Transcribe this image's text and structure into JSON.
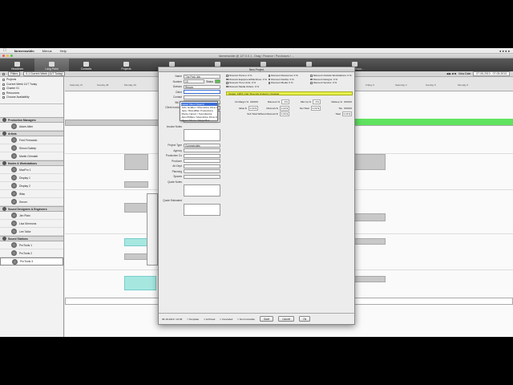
{
  "menubar": {
    "app": "farmerswidin",
    "items": [
      "Menus",
      "Help"
    ]
  },
  "window": {
    "title": "farmerswidin @ 127.0.0.1 - Drag / Finance / Purchases / ..."
  },
  "toolbar": {
    "items": [
      "Headlines",
      "Lang Paint",
      "Contacts",
      "Projects",
      "Invoice Project",
      "Event Schedule",
      "Direct Reports",
      "Projects",
      "Notes / Docs..."
    ]
  },
  "subbar": {
    "filter_label": "Filters",
    "range_label": "0-1 Current Week (11/7 Today)",
    "view_label": "View Date",
    "date_range": "07-05-2013 - 07-05-2013"
  },
  "filters": [
    "Projects",
    "Current Week 11/7 Today",
    "Charter 01",
    "Resources",
    "Choose Availability"
  ],
  "left_panel": {
    "categories": [
      {
        "name": "Production Managers",
        "people": [
          "Adam Allen"
        ]
      },
      {
        "name": "Artists",
        "people": [
          "Fred Fernando",
          "Simon Daleep",
          "Martin Grimaldi"
        ]
      },
      {
        "name": "Nodes & Workstations",
        "people": [
          "MacPro 1",
          "Display 1",
          "Display 2",
          "iMac",
          "Server"
        ]
      },
      {
        "name": "Sound Designers & Engineers",
        "people": [
          "Jim Plain",
          "Lisa Simmons",
          "Lee Tailor"
        ]
      },
      {
        "name": "Sound Stations",
        "people": [
          "ProTools 1",
          "ProTools 2",
          "ProTools 3"
        ]
      }
    ]
  },
  "grid": {
    "days": [
      "Saturday 27",
      "Sunday 28",
      "Monday 29",
      "Tuesday 30",
      "Wednesday 1",
      "Thursday 2",
      "Friday 3",
      "Saturday 4",
      "Sunday 5",
      "Monday 6"
    ]
  },
  "dialog": {
    "title": "New Project",
    "fields": [
      {
        "label": "Name",
        "value": "The Pork Job"
      },
      {
        "label": "Number",
        "value": "19"
      },
      {
        "label": "Division",
        "value": "Recurs"
      },
      {
        "label": "Client",
        "value": ""
      },
      {
        "label": "Contact",
        "value": ""
      },
      {
        "label": "Bill To",
        "value": ""
      },
      {
        "label": "Client Invoices",
        "value": ""
      }
    ],
    "status_label": "Status",
    "invoice_notes_label": "Invoice Notes",
    "project_type_label": "Project Type",
    "project_type_value": "Commercials",
    "fields2": [
      "Agency",
      "Production Co",
      "Producer",
      "Art Dept",
      "Planning",
      "Spaces",
      "Quote Notes",
      "Quote Estimated"
    ],
    "client_dropdown": [
      "Gewel Client (Select)",
      "John Godber / Moonshine Films Inc.",
      "Jane / Brandfilter Productions",
      "Monte Carson / Soundworks",
      "Alan Phillips / Moonshine Films Inc.",
      "Moses Moore / Mega Plus"
    ],
    "checkboxes": [
      "Discount Person: 0 %",
      "Discount Resources: 0 %",
      "Discount Outside Workstations: 0 %",
      "Discount Equipment/Machines: 0 %",
      "Discount Facility: 0 %",
      "Discount Designs: 0 %",
      "Discount Time Units: 0 %",
      "Discount Media: 0 %",
      "Discount Service: 0 %",
      "Discount Media Orders: 0 %"
    ],
    "yellow_bar": "Output: 138.5 | Net Time Hrs 0 Hours | Invoiced",
    "rates": [
      {
        "label": "Fit Margin %",
        "value": ""
      },
      {
        "label": "Discount %",
        "value": "0%"
      },
      {
        "label": "Mkt Up %",
        "value": "0%"
      },
      {
        "label": "Markup %",
        "value": ""
      },
      {
        "label": "Value $",
        "value": "0.00 $"
      },
      {
        "label": "Discount $",
        "value": "0.00 $"
      },
      {
        "label": "Net Total",
        "value": "0.00 $"
      },
      {
        "label": "Tax",
        "value": ""
      },
      {
        "label": "Sub Total Without Discount $",
        "value": "0.00 $"
      },
      {
        "label": "Total",
        "value": "0.00 $"
      }
    ],
    "footer_date": "06-16-2013 / 10:05",
    "footer_checks": [
      "Template",
      "Archived",
      "Cancelled",
      "Not Invoicable"
    ],
    "buttons": {
      "ok": "Ok",
      "cancel": "Cancel",
      "apply": "Apply",
      "save": "Save"
    }
  },
  "colors": {
    "toolbar": "#3b3b3b",
    "green": "#5fe35f",
    "teal": "#a6e8e0",
    "yellow": "#e6f04a"
  }
}
